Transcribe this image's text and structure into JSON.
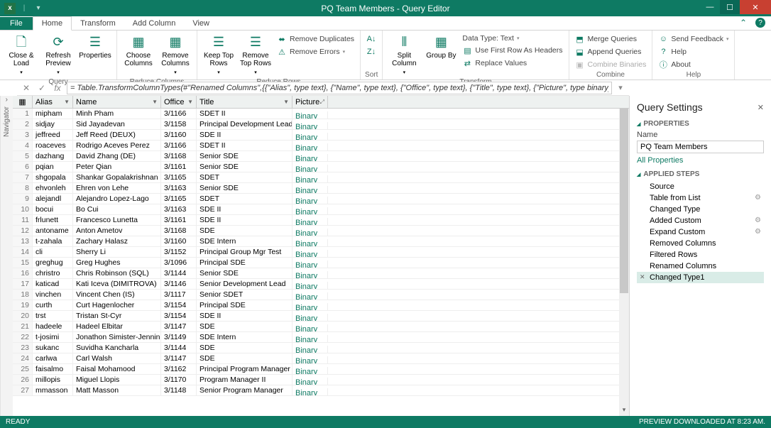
{
  "title": "PQ Team Members - Query Editor",
  "tabs": {
    "file": "File",
    "home": "Home",
    "transform": "Transform",
    "addcolumn": "Add Column",
    "view": "View"
  },
  "ribbon": {
    "query": {
      "closeload": "Close & Load",
      "refresh": "Refresh Preview",
      "properties": "Properties",
      "label": "Query"
    },
    "reducecols": {
      "choose": "Choose Columns",
      "remove": "Remove Columns",
      "label": "Reduce Columns"
    },
    "reducerows": {
      "keeptop": "Keep Top Rows",
      "removetop": "Remove Top Rows",
      "removedup": "Remove Duplicates",
      "removeerr": "Remove Errors",
      "label": "Reduce Rows"
    },
    "sort": {
      "label": "Sort"
    },
    "transform": {
      "split": "Split Column",
      "groupby": "Group By",
      "datatype": "Data Type: Text",
      "firstrow": "Use First Row As Headers",
      "replace": "Replace Values",
      "label": "Transform"
    },
    "combine": {
      "merge": "Merge Queries",
      "append": "Append Queries",
      "binaries": "Combine Binaries",
      "label": "Combine"
    },
    "help": {
      "feedback": "Send Feedback",
      "helpbtn": "Help",
      "about": "About",
      "label": "Help"
    }
  },
  "formula": "= Table.TransformColumnTypes(#\"Renamed Columns\",{{\"Alias\", type text}, {\"Name\", type text}, {\"Office\", type text}, {\"Title\", type text}, {\"Picture\", type binary}})",
  "navigator_label": "Navigator",
  "columns": {
    "alias": "Alias",
    "name": "Name",
    "office": "Office",
    "title": "Title",
    "picture": "Picture"
  },
  "rows": [
    {
      "n": 1,
      "alias": "mipham",
      "name": "Minh Pham",
      "office": "3/1166",
      "title": "SDET II",
      "picture": "Binary"
    },
    {
      "n": 2,
      "alias": "sidjay",
      "name": "Sid Jayadevan",
      "office": "3/1158",
      "title": "Principal Development Lead",
      "picture": "Binary"
    },
    {
      "n": 3,
      "alias": "jeffreed",
      "name": "Jeff Reed (DEUX)",
      "office": "3/1160",
      "title": "SDE II",
      "picture": "Binary"
    },
    {
      "n": 4,
      "alias": "roaceves",
      "name": "Rodrigo Aceves Perez",
      "office": "3/1166",
      "title": "SDET II",
      "picture": "Binary"
    },
    {
      "n": 5,
      "alias": "dazhang",
      "name": "David Zhang (DE)",
      "office": "3/1168",
      "title": "Senior SDE",
      "picture": "Binary"
    },
    {
      "n": 6,
      "alias": "pqian",
      "name": "Peter Qian",
      "office": "3/1161",
      "title": "Senior SDE",
      "picture": "Binary"
    },
    {
      "n": 7,
      "alias": "shgopala",
      "name": "Shankar Gopalakrishnan",
      "office": "3/1165",
      "title": "SDET",
      "picture": "Binary"
    },
    {
      "n": 8,
      "alias": "ehvonleh",
      "name": "Ehren von Lehe",
      "office": "3/1163",
      "title": "Senior SDE",
      "picture": "Binary"
    },
    {
      "n": 9,
      "alias": "alejandl",
      "name": "Alejandro Lopez-Lago",
      "office": "3/1165",
      "title": "SDET",
      "picture": "Binary"
    },
    {
      "n": 10,
      "alias": "bocui",
      "name": "Bo Cui",
      "office": "3/1163",
      "title": "SDE II",
      "picture": "Binary"
    },
    {
      "n": 11,
      "alias": "frlunett",
      "name": "Francesco Lunetta",
      "office": "3/1161",
      "title": "SDE II",
      "picture": "Binary"
    },
    {
      "n": 12,
      "alias": "antoname",
      "name": "Anton Ametov",
      "office": "3/1168",
      "title": "SDE",
      "picture": "Binary"
    },
    {
      "n": 13,
      "alias": "t-zahala",
      "name": "Zachary Halasz",
      "office": "3/1160",
      "title": "SDE Intern",
      "picture": "Binary"
    },
    {
      "n": 14,
      "alias": "cli",
      "name": "Sherry Li",
      "office": "3/1152",
      "title": "Principal Group Mgr Test",
      "picture": "Binary"
    },
    {
      "n": 15,
      "alias": "greghug",
      "name": "Greg Hughes",
      "office": "3/1096",
      "title": "Principal SDE",
      "picture": "Binary"
    },
    {
      "n": 16,
      "alias": "christro",
      "name": "Chris Robinson (SQL)",
      "office": "3/1144",
      "title": "Senior SDE",
      "picture": "Binary"
    },
    {
      "n": 17,
      "alias": "katicad",
      "name": "Kati Iceva (DIMITROVA)",
      "office": "3/1146",
      "title": "Senior Development Lead",
      "picture": "Binary"
    },
    {
      "n": 18,
      "alias": "vinchen",
      "name": "Vincent Chen (IS)",
      "office": "3/1117",
      "title": "Senior SDET",
      "picture": "Binary"
    },
    {
      "n": 19,
      "alias": "curth",
      "name": "Curt Hagenlocher",
      "office": "3/1154",
      "title": "Principal SDE",
      "picture": "Binary"
    },
    {
      "n": 20,
      "alias": "trst",
      "name": "Tristan St-Cyr",
      "office": "3/1154",
      "title": "SDE II",
      "picture": "Binary"
    },
    {
      "n": 21,
      "alias": "hadeele",
      "name": "Hadeel Elbitar",
      "office": "3/1147",
      "title": "SDE",
      "picture": "Binary"
    },
    {
      "n": 22,
      "alias": "t-josimi",
      "name": "Jonathon Simister-Jennings",
      "office": "3/1149",
      "title": "SDE Intern",
      "picture": "Binary"
    },
    {
      "n": 23,
      "alias": "sukanc",
      "name": "Suvidha Kancharla",
      "office": "3/1144",
      "title": "SDE",
      "picture": "Binary"
    },
    {
      "n": 24,
      "alias": "carlwa",
      "name": "Carl Walsh",
      "office": "3/1147",
      "title": "SDE",
      "picture": "Binary"
    },
    {
      "n": 25,
      "alias": "faisalmo",
      "name": "Faisal Mohamood",
      "office": "3/1162",
      "title": "Principal Program Manager Lead",
      "picture": "Binary"
    },
    {
      "n": 26,
      "alias": "millopis",
      "name": "Miguel Llopis",
      "office": "3/1170",
      "title": "Program Manager II",
      "picture": "Binary"
    },
    {
      "n": 27,
      "alias": "mmasson",
      "name": "Matt Masson",
      "office": "3/1148",
      "title": "Senior Program Manager",
      "picture": "Binary"
    }
  ],
  "settings": {
    "title": "Query Settings",
    "properties_label": "PROPERTIES",
    "name_label": "Name",
    "name_value": "PQ Team Members",
    "all_props": "All Properties",
    "steps_label": "APPLIED STEPS",
    "steps": [
      {
        "label": "Source",
        "gear": false
      },
      {
        "label": "Table from List",
        "gear": true
      },
      {
        "label": "Changed Type",
        "gear": false
      },
      {
        "label": "Added Custom",
        "gear": true
      },
      {
        "label": "Expand Custom",
        "gear": true
      },
      {
        "label": "Removed Columns",
        "gear": false
      },
      {
        "label": "Filtered Rows",
        "gear": false
      },
      {
        "label": "Renamed Columns",
        "gear": false
      },
      {
        "label": "Changed Type1",
        "gear": false,
        "selected": true
      }
    ]
  },
  "status": {
    "left": "READY",
    "right": "PREVIEW DOWNLOADED AT 8:23 AM."
  }
}
